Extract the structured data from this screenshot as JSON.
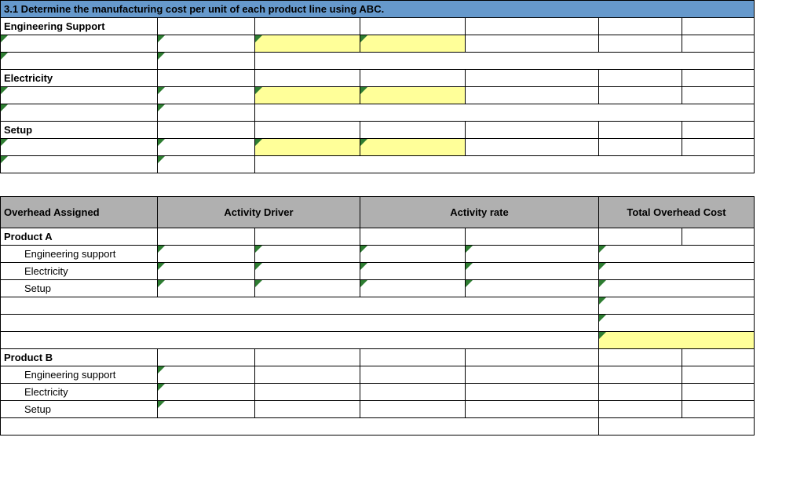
{
  "title": "3.1  Determine the manufacturing cost per unit of each product line using ABC.",
  "sections": {
    "engSupport": "Engineering Support",
    "electricity": "Electricity",
    "setup": "Setup"
  },
  "tableHeaders": {
    "overheadAssigned": "Overhead Assigned",
    "activityDriver": "Activity Driver",
    "activityRate": "Activity rate",
    "totalOverheadCost": "Total Overhead Cost"
  },
  "products": {
    "a": {
      "name": "Product A",
      "rows": [
        "Engineering support",
        "Electricity",
        "Setup"
      ]
    },
    "b": {
      "name": "Product B",
      "rows": [
        "Engineering support",
        "Electricity",
        "Setup"
      ]
    }
  }
}
